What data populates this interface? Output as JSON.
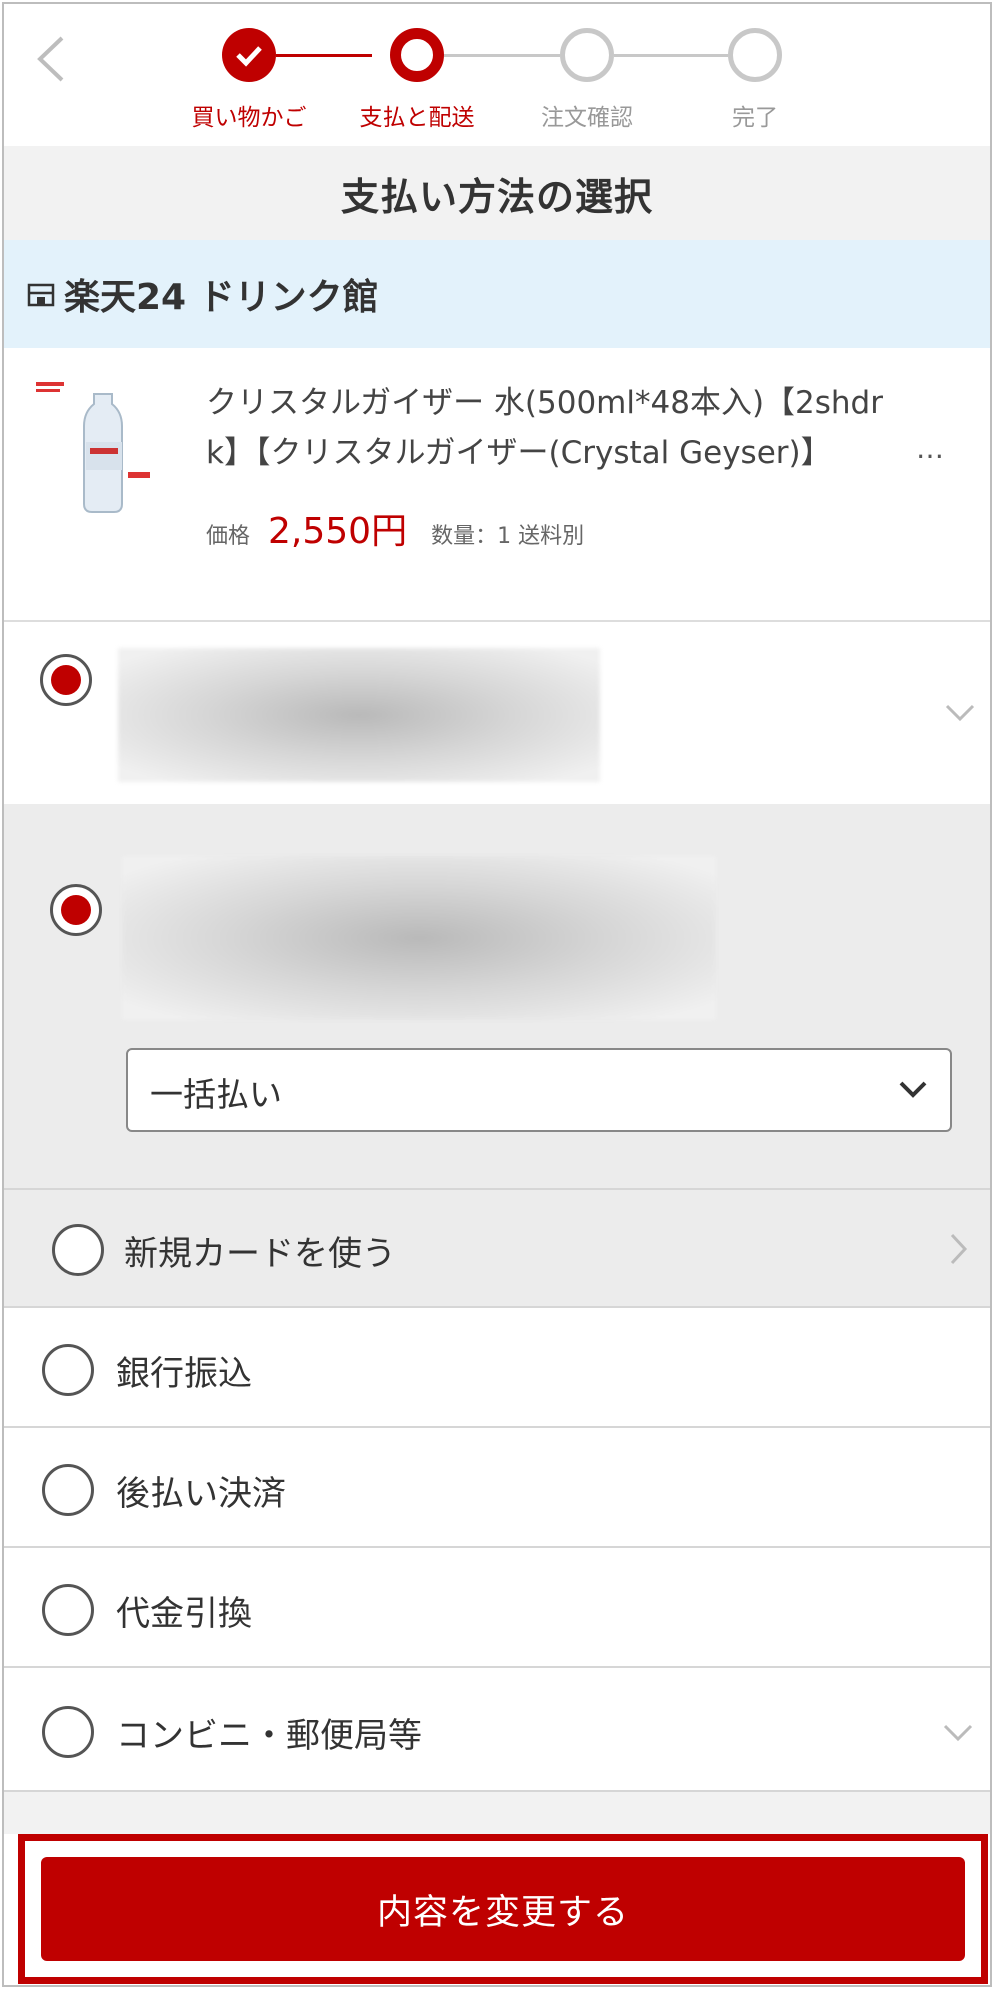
{
  "stepper": {
    "steps": [
      {
        "label": "買い物かご",
        "state": "done"
      },
      {
        "label": "支払と配送",
        "state": "current"
      },
      {
        "label": "注文確認",
        "state": "todo"
      },
      {
        "label": "完了",
        "state": "todo"
      }
    ]
  },
  "page_title": "支払い方法の選択",
  "shop": {
    "name": "楽天24 ドリンク館",
    "icon": "shop-icon"
  },
  "product": {
    "name_line1": "クリスタルガイザー 水(500ml*48本入)【2shdr",
    "name_line2": "k】【クリスタルガイザー(Crystal Geyser)】",
    "ellipsis": "…",
    "price_label": "価格",
    "price": "2,550円",
    "quantity_shipping": "数量：1 送料別"
  },
  "payment": {
    "installment_select": {
      "selected": "一括払い"
    },
    "new_card_label": "新規カードを使う",
    "options": [
      {
        "label": "銀行振込",
        "checked": false
      },
      {
        "label": "後払い決済",
        "checked": false
      },
      {
        "label": "代金引換",
        "checked": false
      },
      {
        "label": "コンビニ・郵便局等",
        "checked": false
      }
    ]
  },
  "cta": {
    "label": "内容を変更する"
  },
  "colors": {
    "accent": "#bf0000",
    "shop_bar": "#e3f2fb",
    "section_gray": "#ececec"
  }
}
